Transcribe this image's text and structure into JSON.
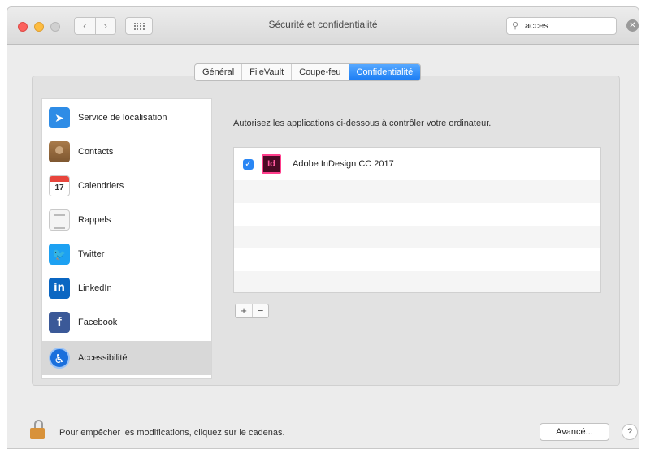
{
  "window": {
    "title": "Sécurité et confidentialité",
    "nav_back": "‹",
    "nav_forward": "›"
  },
  "search": {
    "value": "acces",
    "icon": "magnifier-icon",
    "clear": "✕"
  },
  "tabs": [
    {
      "label": "Général",
      "active": false
    },
    {
      "label": "FileVault",
      "active": false
    },
    {
      "label": "Coupe-feu",
      "active": false
    },
    {
      "label": "Confidentialité",
      "active": true
    }
  ],
  "sidebar": {
    "items": [
      {
        "label": "Service de localisation",
        "icon": "location-arrow-icon",
        "glyph": "➤"
      },
      {
        "label": "Contacts",
        "icon": "contacts-book-icon",
        "glyph": ""
      },
      {
        "label": "Calendriers",
        "icon": "calendar-icon",
        "glyph": "17"
      },
      {
        "label": "Rappels",
        "icon": "reminders-icon",
        "glyph": ""
      },
      {
        "label": "Twitter",
        "icon": "twitter-bird-icon",
        "glyph": "🐦"
      },
      {
        "label": "LinkedIn",
        "icon": "linkedin-icon",
        "glyph": "in"
      },
      {
        "label": "Facebook",
        "icon": "facebook-icon",
        "glyph": "f"
      },
      {
        "label": "Accessibilité",
        "icon": "accessibility-icon",
        "glyph": "♿",
        "selected": true
      }
    ]
  },
  "main": {
    "description": "Autorisez les applications ci-dessous à contrôler votre ordinateur.",
    "apps": [
      {
        "name": "Adobe InDesign CC 2017",
        "checked": true,
        "icon_text": "Id"
      }
    ],
    "add": "+",
    "remove": "−"
  },
  "footer": {
    "lock_text": "Pour empêcher les modifications, cliquez sur le cadenas.",
    "advanced_label": "Avancé...",
    "help": "?"
  },
  "colors": {
    "accent": "#1b7df4",
    "close": "#fc615d",
    "minimize": "#fdbc40",
    "indesign": "#ff3e8c"
  }
}
